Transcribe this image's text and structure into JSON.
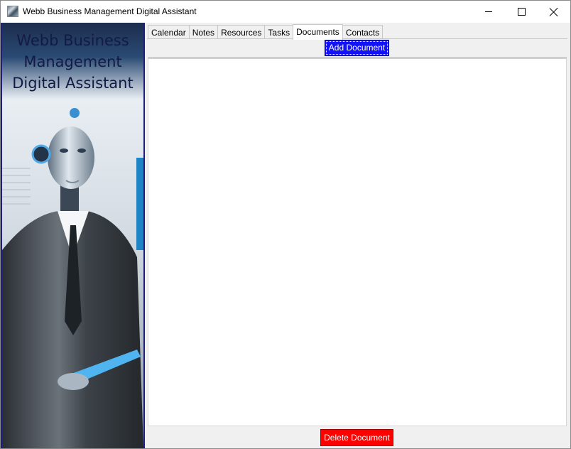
{
  "window": {
    "title": "Webb Business Management Digital Assistant"
  },
  "sidebar": {
    "title_lines": [
      "Webb Business",
      "Management",
      "Digital Assistant"
    ]
  },
  "tabs": [
    {
      "label": "Calendar"
    },
    {
      "label": "Notes"
    },
    {
      "label": "Resources"
    },
    {
      "label": "Tasks"
    },
    {
      "label": "Documents",
      "active": true
    },
    {
      "label": "Contacts"
    }
  ],
  "documents": {
    "add_label": "Add Document",
    "delete_label": "Delete Document",
    "items": []
  },
  "colors": {
    "add_button": "#1313f5",
    "delete_button": "#ff0000",
    "sidebar_border": "#1c1f7c",
    "sidebar_title": "#131a45"
  },
  "icons": {
    "app": "robot-app-icon",
    "minimize": "minimize-icon",
    "maximize": "maximize-icon",
    "close": "close-icon"
  }
}
